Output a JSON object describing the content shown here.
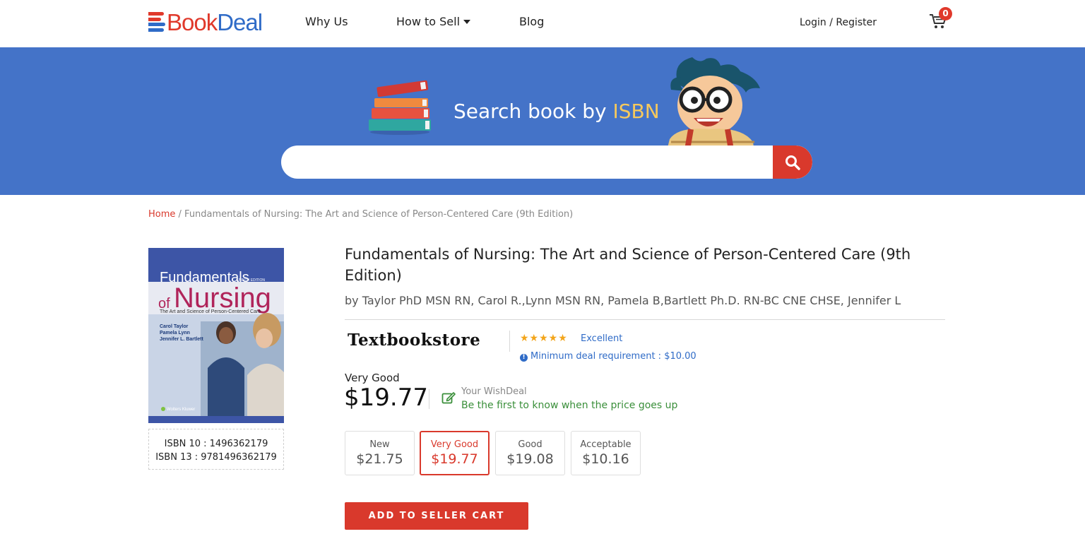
{
  "header": {
    "logo_book": "Book",
    "logo_deal": "Deal",
    "nav": {
      "why_us": "Why Us",
      "how_to_sell": "How to Sell",
      "blog": "Blog"
    },
    "login": "Login / Register",
    "cart_count": "0"
  },
  "hero": {
    "title_prefix": "Search book by ",
    "title_highlight": "ISBN",
    "search_placeholder": "",
    "search_value": ""
  },
  "breadcrumb": {
    "home": "Home",
    "separator": " / ",
    "current": "Fundamentals of Nursing: The Art and Science of Person-Centered Care (9th Edition)"
  },
  "book": {
    "cover": {
      "series_word": "Fundamentals",
      "edition": "NINTH EDITION",
      "of_word": "of",
      "big_word": "Nursing",
      "subtitle": "The Art and Science of Person-Centered Care",
      "authors": [
        "Carol Taylor",
        "Pamela Lynn",
        "Jennifer L. Bartlett"
      ],
      "publisher": "Wolters Kluwer"
    },
    "isbn10": "ISBN 10 : 1496362179",
    "isbn13": "ISBN 13 : 9781496362179",
    "title": "Fundamentals of Nursing: The Art and Science of Person-Centered Care (9th Edition)",
    "authors": "by Taylor PhD MSN RN, Carol R.,Lynn MSN RN, Pamela B,Bartlett Ph.D. RN-BC CNE CHSE, Jennifer L"
  },
  "seller": {
    "name": "Textbookstore",
    "stars": "★★★★★",
    "rating_label": "Excellent",
    "min_deal": "Minimum deal requirement : $10.00"
  },
  "selected": {
    "condition": "Very Good",
    "price": "$19.77"
  },
  "wishdeal": {
    "title": "Your WishDeal",
    "subtitle": "Be the first to know when the price goes up"
  },
  "conditions": [
    {
      "name": "New",
      "price": "$21.75",
      "selected": false
    },
    {
      "name": "Very Good",
      "price": "$19.77",
      "selected": true
    },
    {
      "name": "Good",
      "price": "$19.08",
      "selected": false
    },
    {
      "name": "Acceptable",
      "price": "$10.16",
      "selected": false
    }
  ],
  "actions": {
    "add_to_cart": "ADD TO SELLER CART"
  },
  "colors": {
    "brand_red": "#d9392c",
    "brand_blue": "#2f6bc7",
    "hero_blue": "#4473c8",
    "star": "#f3a51b",
    "wish_green": "#3a8f3a"
  }
}
